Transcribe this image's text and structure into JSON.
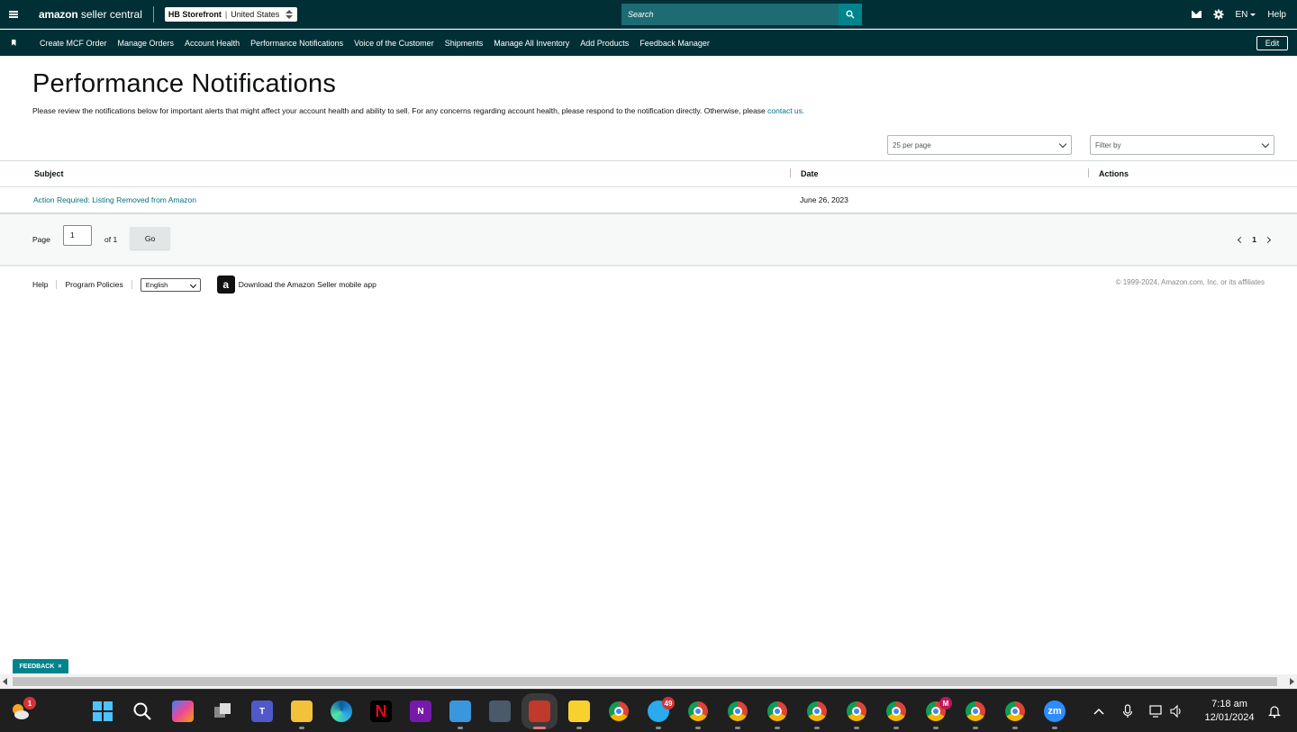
{
  "topbar": {
    "logo_brand": "amazon",
    "logo_product": "seller central",
    "store_name": "HB Storefront",
    "store_region": "United States",
    "search_placeholder": "Search",
    "language": "EN",
    "help": "Help"
  },
  "nav": {
    "items": [
      "Create MCF Order",
      "Manage Orders",
      "Account Health",
      "Performance Notifications",
      "Voice of the Customer",
      "Shipments",
      "Manage All Inventory",
      "Add Products",
      "Feedback Manager"
    ],
    "edit": "Edit"
  },
  "page": {
    "title": "Performance Notifications",
    "description": "Please review the notifications below for important alerts that might affect your account health and ability to sell. For any concerns regarding account health, please respond to the notification directly. Otherwise, please",
    "contact_link": "contact us.",
    "per_page": "25 per page",
    "filter_placeholder": "Filter by"
  },
  "table": {
    "columns": [
      "Subject",
      "Date",
      "Actions"
    ],
    "rows": [
      {
        "subject": "Action Required: Listing Removed from Amazon",
        "date": "June 26, 2023",
        "actions": ""
      }
    ]
  },
  "pagination": {
    "page_label": "Page",
    "page_value": "1",
    "of_label": "of 1",
    "go": "Go",
    "current": "1"
  },
  "footer": {
    "help": "Help",
    "program_policies": "Program Policies",
    "language": "English",
    "app_link": "Download the Amazon Seller mobile app",
    "copyright": "© 1999-2024, Amazon.com, Inc. or its affiliates"
  },
  "feedback": {
    "label": "FEEDBACK",
    "close": "×"
  },
  "taskbar": {
    "time": "7:18 am",
    "date": "12/01/2024",
    "badges": {
      "start": "1",
      "telegram": "49",
      "chrome_m": "M"
    },
    "icons": [
      "weather-icon",
      "windows-start-icon",
      "search-icon",
      "copilot-icon",
      "task-view-icon",
      "teams-icon",
      "file-explorer-icon",
      "edge-icon",
      "netflix-icon",
      "onenote-icon",
      "notepad-icon",
      "calculator-icon",
      "snipping-tool-icon",
      "sticky-notes-icon",
      "chrome-icon",
      "telegram-icon",
      "chrome-profile-1-icon",
      "chrome-profile-2-icon",
      "chrome-profile-3-icon",
      "chrome-profile-4-icon",
      "chrome-profile-5-icon",
      "chrome-profile-6-icon",
      "chrome-profile-7-icon",
      "chrome-profile-8-icon",
      "chrome-profile-9-icon",
      "zoom-icon"
    ]
  },
  "colors": {
    "header_bg": "#002f36",
    "search_bg": "#1d6b73",
    "accent": "#00848b",
    "link": "#007185"
  }
}
